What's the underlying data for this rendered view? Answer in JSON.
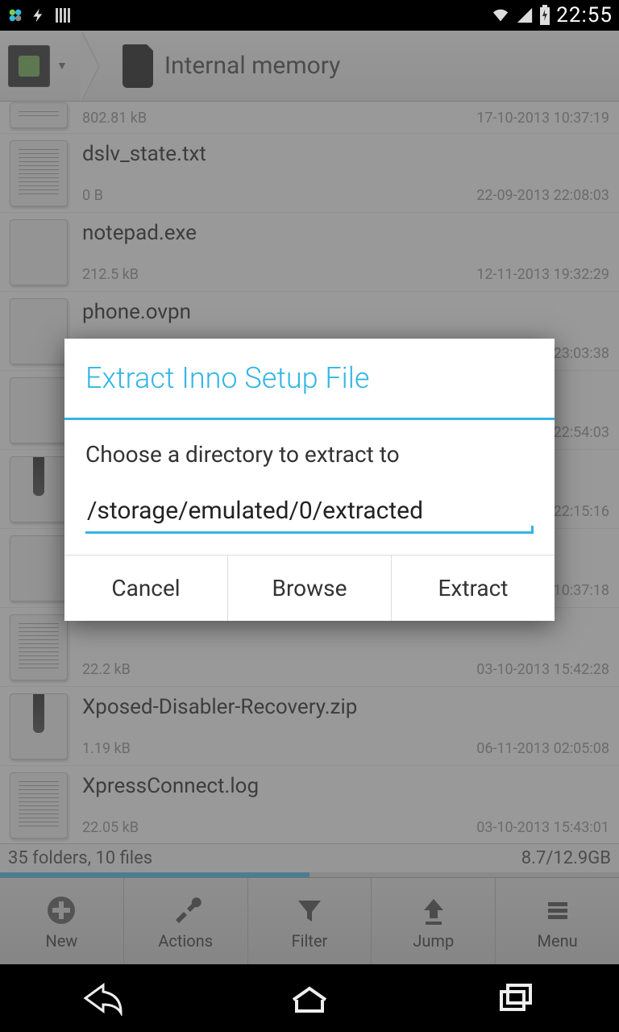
{
  "status": {
    "time": "22:55"
  },
  "breadcrumb": {
    "location": "Internal memory"
  },
  "files": [
    {
      "name": "",
      "size": "802.81 kB",
      "date": "17-10-2013 10:37:19",
      "type": "doc"
    },
    {
      "name": "dslv_state.txt",
      "size": "0 B",
      "date": "22-09-2013 22:08:03",
      "type": "doc"
    },
    {
      "name": "notepad.exe",
      "size": "212.5 kB",
      "date": "12-11-2013 19:32:29",
      "type": "blank"
    },
    {
      "name": "phone.ovpn",
      "size": "",
      "date": "3 23:03:38",
      "type": "blank"
    },
    {
      "name": "",
      "size": "",
      "date": "3 22:54:03",
      "type": "blank"
    },
    {
      "name": "",
      "size": "",
      "date": "3 22:15:16",
      "type": "zip"
    },
    {
      "name": "",
      "size": "",
      "date": "3 10:37:18",
      "type": "blank"
    },
    {
      "name": "",
      "size": "22.2 kB",
      "date": "03-10-2013 15:42:28",
      "type": "doc"
    },
    {
      "name": "Xposed-Disabler-Recovery.zip",
      "size": "1.19 kB",
      "date": "06-11-2013 02:05:08",
      "type": "zip"
    },
    {
      "name": "XpressConnect.log",
      "size": "22.05 kB",
      "date": "03-10-2013 15:43:01",
      "type": "doc"
    }
  ],
  "summary": {
    "folders": "35 folders, 10 files",
    "storage": "8.7/12.9GB"
  },
  "toolbar": {
    "new": "New",
    "actions": "Actions",
    "filter": "Filter",
    "jump": "Jump",
    "menu": "Menu"
  },
  "dialog": {
    "title": "Extract Inno Setup File",
    "message": "Choose a directory to extract to",
    "path": "/storage/emulated/0/extracted",
    "cancel": "Cancel",
    "browse": "Browse",
    "extract": "Extract"
  }
}
